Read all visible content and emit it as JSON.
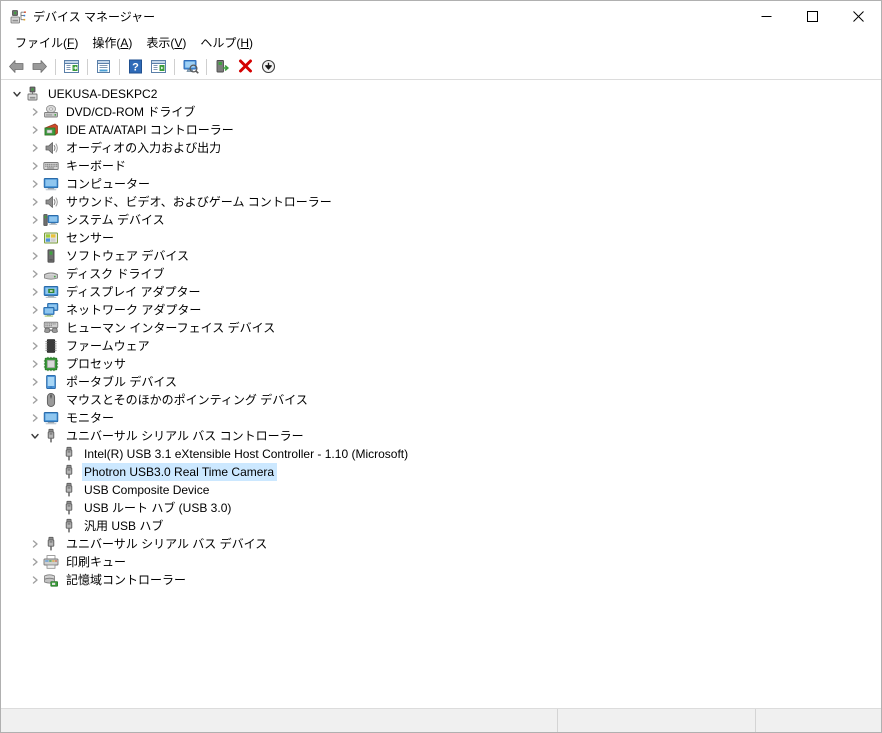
{
  "window": {
    "title": "デバイス マネージャー",
    "icon": "device-manager-icon",
    "controls": {
      "minimize": "minimize-icon",
      "maximize": "maximize-icon",
      "close": "close-icon"
    }
  },
  "menubar": {
    "items": [
      {
        "label": "ファイル(F)",
        "text": "ファイル(",
        "accel": "F",
        "tail": ")"
      },
      {
        "label": "操作(A)",
        "text": "操作(",
        "accel": "A",
        "tail": ")"
      },
      {
        "label": "表示(V)",
        "text": "表示(",
        "accel": "V",
        "tail": ")"
      },
      {
        "label": "ヘルプ(H)",
        "text": "ヘルプ(",
        "accel": "H",
        "tail": ")"
      }
    ]
  },
  "toolbar": {
    "buttons": [
      {
        "name": "back-button",
        "icon": "left-arrow-icon"
      },
      {
        "name": "forward-button",
        "icon": "right-arrow-icon"
      },
      {
        "name": "separator-1",
        "icon": "separator"
      },
      {
        "name": "show-hide-console-tree-button",
        "icon": "console-tree-icon"
      },
      {
        "name": "separator-2",
        "icon": "separator"
      },
      {
        "name": "properties-button",
        "icon": "properties-icon"
      },
      {
        "name": "separator-3",
        "icon": "separator"
      },
      {
        "name": "help-button",
        "icon": "help-question-icon"
      },
      {
        "name": "show-window-button",
        "icon": "window-play-icon"
      },
      {
        "name": "separator-4",
        "icon": "separator"
      },
      {
        "name": "scan-hardware-changes-button",
        "icon": "scan-monitor-icon"
      },
      {
        "name": "separator-5",
        "icon": "separator"
      },
      {
        "name": "update-driver-button",
        "icon": "update-driver-icon"
      },
      {
        "name": "uninstall-device-button",
        "icon": "red-x-icon"
      },
      {
        "name": "disable-device-button",
        "icon": "disable-arrow-down-icon"
      }
    ]
  },
  "tree": {
    "root": {
      "label": "UEKUSA-DESKPC2",
      "icon": "computer-root-icon",
      "expanded": true,
      "depth": 0
    },
    "categories": [
      {
        "label": "DVD/CD-ROM ドライブ",
        "icon": "dvd-drive-icon",
        "expanded": false,
        "depth": 1
      },
      {
        "label": "IDE ATA/ATAPI コントローラー",
        "icon": "ide-controller-icon",
        "expanded": false,
        "depth": 1
      },
      {
        "label": "オーディオの入力および出力",
        "icon": "audio-speaker-icon",
        "expanded": false,
        "depth": 1
      },
      {
        "label": "キーボード",
        "icon": "keyboard-icon",
        "expanded": false,
        "depth": 1
      },
      {
        "label": "コンピューター",
        "icon": "monitor-icon",
        "expanded": false,
        "depth": 1
      },
      {
        "label": "サウンド、ビデオ、およびゲーム コントローラー",
        "icon": "audio-speaker-icon",
        "expanded": false,
        "depth": 1
      },
      {
        "label": "システム デバイス",
        "icon": "system-device-icon",
        "expanded": false,
        "depth": 1
      },
      {
        "label": "センサー",
        "icon": "sensor-icon",
        "expanded": false,
        "depth": 1
      },
      {
        "label": "ソフトウェア デバイス",
        "icon": "software-device-icon",
        "expanded": false,
        "depth": 1
      },
      {
        "label": "ディスク ドライブ",
        "icon": "disk-drive-icon",
        "expanded": false,
        "depth": 1
      },
      {
        "label": "ディスプレイ アダプター",
        "icon": "display-adapter-icon",
        "expanded": false,
        "depth": 1
      },
      {
        "label": "ネットワーク アダプター",
        "icon": "network-adapter-icon",
        "expanded": false,
        "depth": 1
      },
      {
        "label": "ヒューマン インターフェイス デバイス",
        "icon": "hid-icon",
        "expanded": false,
        "depth": 1
      },
      {
        "label": "ファームウェア",
        "icon": "firmware-icon",
        "expanded": false,
        "depth": 1
      },
      {
        "label": "プロセッサ",
        "icon": "processor-icon",
        "expanded": false,
        "depth": 1
      },
      {
        "label": "ポータブル デバイス",
        "icon": "portable-device-icon",
        "expanded": false,
        "depth": 1
      },
      {
        "label": "マウスとそのほかのポインティング デバイス",
        "icon": "mouse-icon",
        "expanded": false,
        "depth": 1
      },
      {
        "label": "モニター",
        "icon": "monitor-icon",
        "expanded": false,
        "depth": 1
      },
      {
        "label": "ユニバーサル シリアル バス コントローラー",
        "icon": "usb-icon",
        "expanded": true,
        "depth": 1
      }
    ],
    "usb_children": [
      {
        "label": "Intel(R) USB 3.1 eXtensible Host Controller - 1.10 (Microsoft)",
        "icon": "usb-icon",
        "depth": 2,
        "selected": false
      },
      {
        "label": "Photron USB3.0 Real Time Camera",
        "icon": "usb-icon",
        "depth": 2,
        "selected": true
      },
      {
        "label": "USB Composite Device",
        "icon": "usb-icon",
        "depth": 2,
        "selected": false
      },
      {
        "label": "USB ルート ハブ (USB 3.0)",
        "icon": "usb-icon",
        "depth": 2,
        "selected": false
      },
      {
        "label": "汎用 USB ハブ",
        "icon": "usb-icon",
        "depth": 2,
        "selected": false
      }
    ],
    "trailing_categories": [
      {
        "label": "ユニバーサル シリアル バス デバイス",
        "icon": "usb-icon",
        "expanded": false,
        "depth": 1
      },
      {
        "label": "印刷キュー",
        "icon": "printer-icon",
        "expanded": false,
        "depth": 1
      },
      {
        "label": "記憶域コントローラー",
        "icon": "storage-controller-icon",
        "expanded": false,
        "depth": 1
      }
    ]
  },
  "statusbar": {
    "panes": [
      "",
      "",
      ""
    ]
  },
  "colors": {
    "selection": "#cce8ff",
    "window_bg": "#ffffff",
    "statusbar_bg": "#f0f0f0",
    "accent_blue": "#2a6ebb",
    "red": "#d40000",
    "green": "#3c9e3c"
  }
}
